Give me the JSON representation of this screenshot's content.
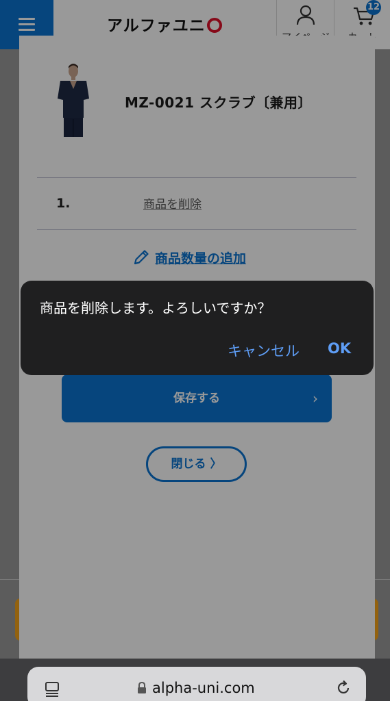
{
  "header": {
    "logo_text": "アルファユニ",
    "mypage_label": "マイページ",
    "cart_label": "カート",
    "cart_count": "12"
  },
  "product": {
    "name": "MZ-0021 スクラブ〔兼用〕",
    "image_icon": "scrub-model-image"
  },
  "item": {
    "number": "1.",
    "delete_label": "商品を削除"
  },
  "actions": {
    "add_quantity_label": "商品数量の追加",
    "save_label": "保存する",
    "save_chevron": "›",
    "close_label": "閉じる",
    "close_chevron": "〉"
  },
  "dialog": {
    "message": "商品を削除します。よろしいですか？",
    "cancel_label": "キャンセル",
    "ok_label": "OK"
  },
  "browser": {
    "url": "alpha-uni.com"
  },
  "colors": {
    "accent": "#0a74d1",
    "dialog_bg": "#1f1f20",
    "dialog_button": "#5e9df5",
    "logo_red": "#e0102a",
    "banner_orange": "#f5a31a"
  }
}
